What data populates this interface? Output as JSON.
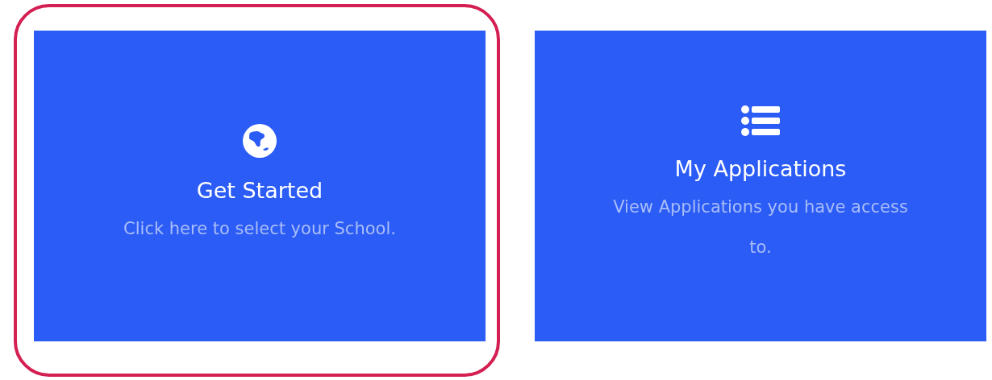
{
  "cards": [
    {
      "kind": "globe",
      "title": "Get Started",
      "subtitle": "Click here to select your School.",
      "highlighted": true
    },
    {
      "kind": "list",
      "title": "My Applications",
      "subtitle": "View Applications you have access to.",
      "highlighted": false
    }
  ]
}
